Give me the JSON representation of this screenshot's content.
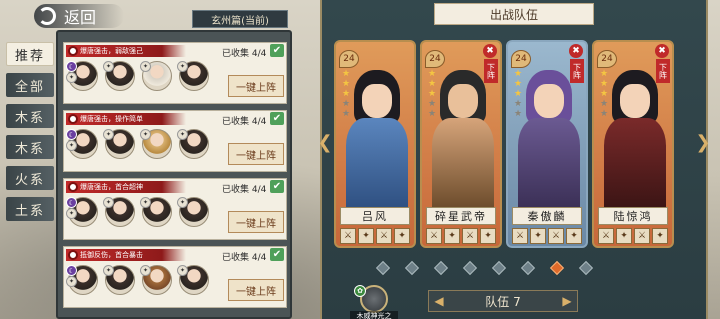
{
  "header": {
    "back_label": "返回",
    "chapter": "玄州篇(当前)"
  },
  "tabs": [
    {
      "label": "推荐",
      "active": true
    },
    {
      "label": "全部",
      "active": false
    },
    {
      "label": "木系",
      "active": false
    },
    {
      "label": "木系",
      "active": false
    },
    {
      "label": "火系",
      "active": false
    },
    {
      "label": "土系",
      "active": false
    }
  ],
  "cards": [
    {
      "tag": "爆唐强击，弱敌强己",
      "collected": "已收集 4/4",
      "button": "一键上阵"
    },
    {
      "tag": "爆唐强击，操作简单",
      "collected": "已收集 4/4",
      "button": "一键上阵"
    },
    {
      "tag": "爆唐强击，首合超神",
      "collected": "已收集 4/4",
      "button": "一键上阵"
    },
    {
      "tag": "抵御反伤，首合暴击",
      "collected": "已收集 4/4",
      "button": "一键上阵"
    }
  ],
  "panel": {
    "title": "出战队伍",
    "team_name": "队伍 7",
    "bond_label": "木威神光之"
  },
  "heroes": [
    {
      "level": "24",
      "name": "吕风",
      "stars": 3,
      "remove": "",
      "remove_label": "",
      "theme": "orange",
      "body_color": "#3c6fa8"
    },
    {
      "level": "24",
      "name": "碎星武帝",
      "stars": 3,
      "remove": "✖",
      "remove_label": "下阵",
      "theme": "orange",
      "body_color": "#6a4a2a"
    },
    {
      "level": "24",
      "name": "秦傲麟",
      "stars": 3,
      "remove": "✖",
      "remove_label": "下阵",
      "theme": "blue",
      "body_color": "#4b3c6a"
    },
    {
      "level": "24",
      "name": "陆惊鸿",
      "stars": 3,
      "remove": "✖",
      "remove_label": "下阵",
      "theme": "orange",
      "body_color": "#5a2020"
    }
  ],
  "colors": {
    "accent": "#c02a2a",
    "frame": "#b88e4f",
    "page_dot_active": "#e06a2a"
  },
  "icons": {
    "back": "back-swirl-icon",
    "check": "check-icon",
    "remove": "close-icon",
    "left_arrow": "chevron-left-icon",
    "right_arrow": "chevron-right-icon"
  }
}
